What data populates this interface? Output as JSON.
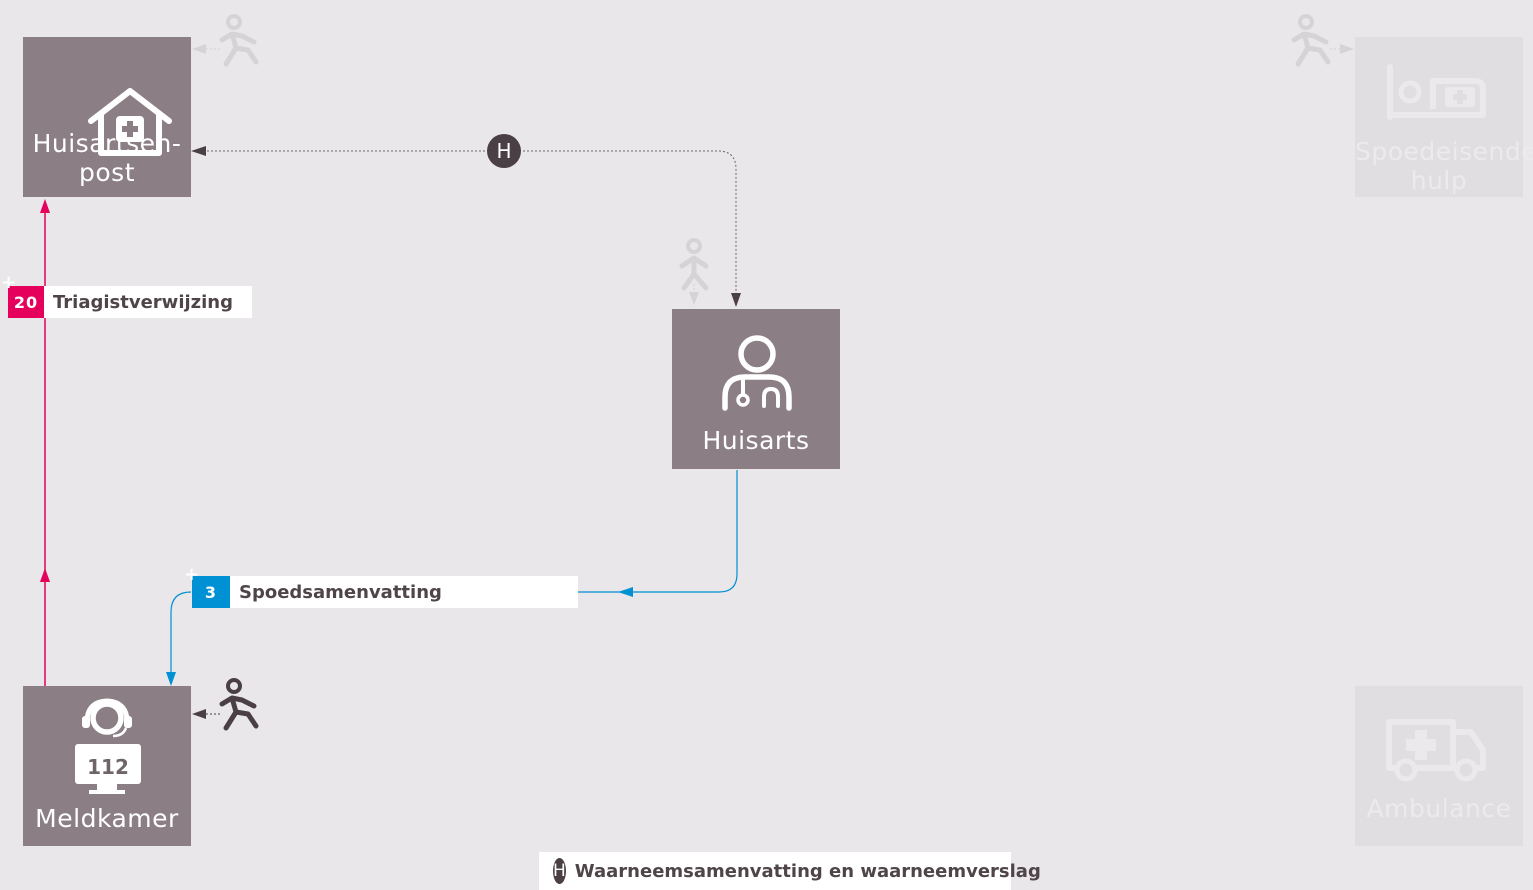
{
  "nodes": {
    "huisartsenpost": {
      "label": "Huisartsen-\npost",
      "icon": "house-medical-icon"
    },
    "huisarts": {
      "label": "Huisarts",
      "icon": "doctor-icon"
    },
    "meldkamer": {
      "label": "Meldkamer",
      "icon": "dispatcher-icon",
      "screen_text": "112"
    },
    "spoedeisende_hulp": {
      "label": "Spoedeisende\nhulp",
      "icon": "hospital-bed-icon"
    },
    "ambulance": {
      "label": "Ambulance",
      "icon": "ambulance-icon"
    }
  },
  "tags": {
    "triage": {
      "number": "20",
      "label": "Triagistverwijzing",
      "color": "#e5005b"
    },
    "spoed": {
      "number": "3",
      "label": "Spoedsamenvatting",
      "color": "#0090d4"
    }
  },
  "hbadge_letter": "H",
  "legend": {
    "letter": "H",
    "text": "Waarneemsamenvatting en waarneemverslag"
  },
  "colors": {
    "node": "#8b7f85",
    "node_faded": "#e0dee0",
    "pink": "#e5005b",
    "blue": "#0090d4",
    "dark": "#4a3f44",
    "background": "#e9e7e9"
  }
}
